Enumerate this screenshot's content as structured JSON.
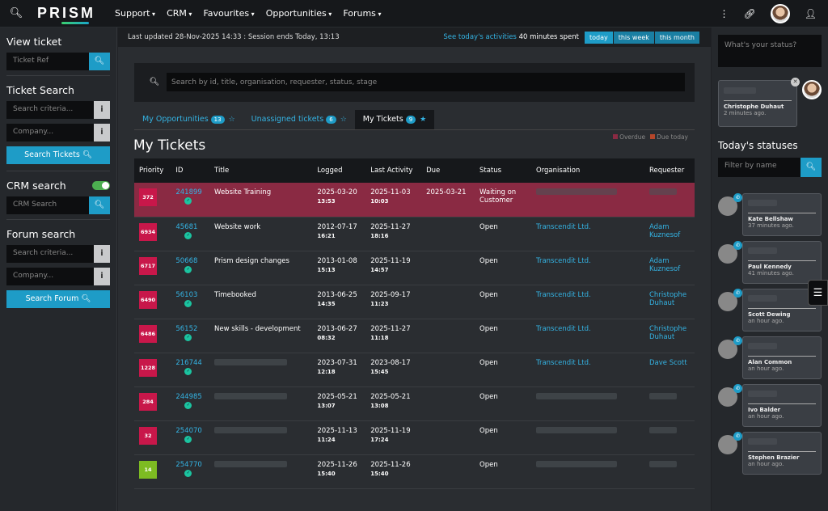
{
  "topbar": {
    "logo": "PRISM",
    "nav": [
      "Support",
      "CRM",
      "Favourites",
      "Opportunities",
      "Forums"
    ]
  },
  "left": {
    "view_ticket": {
      "heading": "View ticket",
      "placeholder": "Ticket Ref"
    },
    "ticket_search": {
      "heading": "Ticket Search",
      "criteria_placeholder": "Search criteria...",
      "company_placeholder": "Company...",
      "button": "Search Tickets"
    },
    "crm_search": {
      "heading": "CRM search",
      "placeholder": "CRM Search"
    },
    "forum_search": {
      "heading": "Forum search",
      "criteria_placeholder": "Search criteria...",
      "company_placeholder": "Company...",
      "button": "Search Forum"
    }
  },
  "status_line": {
    "updated": "Last updated 28-Nov-2025 14:33 : Session ends Today, 13:13",
    "activity_link": "See today's activities",
    "activity_time": "40 minutes spent",
    "periods": [
      "today",
      "this week",
      "this month"
    ]
  },
  "search": {
    "placeholder": "Search by id, title, organisation, requester, status, stage"
  },
  "tabs": [
    {
      "label": "My Opportunities",
      "count": "13"
    },
    {
      "label": "Unassigned tickets",
      "count": "6"
    },
    {
      "label": "My Tickets",
      "count": "9"
    }
  ],
  "legend": {
    "overdue": "Overdue",
    "due_today": "Due today"
  },
  "page_title": "My Tickets",
  "table": {
    "headers": [
      "Priority",
      "ID",
      "Title",
      "Logged",
      "Last Activity",
      "Due",
      "Status",
      "Organisation",
      "Requester"
    ],
    "rows": [
      {
        "priority": "372",
        "color": "#c8174a",
        "id": "241899",
        "title": "Website Training",
        "logged_d": "2025-03-20",
        "logged_t": "13:53",
        "act_d": "2025-11-03",
        "act_t": "10:03",
        "due": "2025-03-21",
        "status": "Waiting on Customer",
        "org": "",
        "req": ""
      },
      {
        "priority": "6934",
        "color": "#c8174a",
        "id": "45681",
        "title": "Website work",
        "logged_d": "2012-07-17",
        "logged_t": "16:21",
        "act_d": "2025-11-27",
        "act_t": "18:16",
        "due": "",
        "status": "Open",
        "org": "Transcendit Ltd.",
        "req": "Adam Kuznesof"
      },
      {
        "priority": "6717",
        "color": "#c8174a",
        "id": "50668",
        "title": "Prism design changes",
        "logged_d": "2013-01-08",
        "logged_t": "15:13",
        "act_d": "2025-11-19",
        "act_t": "14:57",
        "due": "",
        "status": "Open",
        "org": "Transcendit Ltd.",
        "req": "Adam Kuznesof"
      },
      {
        "priority": "6490",
        "color": "#c8174a",
        "id": "56103",
        "title": "Timebooked",
        "logged_d": "2013-06-25",
        "logged_t": "14:35",
        "act_d": "2025-09-17",
        "act_t": "11:23",
        "due": "",
        "status": "Open",
        "org": "Transcendit Ltd.",
        "req": "Christophe Duhaut"
      },
      {
        "priority": "6486",
        "color": "#c8174a",
        "id": "56152",
        "title": "New skills - development",
        "logged_d": "2013-06-27",
        "logged_t": "08:32",
        "act_d": "2025-11-27",
        "act_t": "11:18",
        "due": "",
        "status": "Open",
        "org": "Transcendit Ltd.",
        "req": "Christophe Duhaut"
      },
      {
        "priority": "1228",
        "color": "#c8174a",
        "id": "216744",
        "title": "",
        "logged_d": "2023-07-31",
        "logged_t": "12:18",
        "act_d": "2023-08-17",
        "act_t": "15:45",
        "due": "",
        "status": "Open",
        "org": "Transcendit Ltd.",
        "req": "Dave Scott"
      },
      {
        "priority": "284",
        "color": "#c8174a",
        "id": "244985",
        "title": "",
        "logged_d": "2025-05-21",
        "logged_t": "13:07",
        "act_d": "2025-05-21",
        "act_t": "13:08",
        "due": "",
        "status": "Open",
        "org": "",
        "req": ""
      },
      {
        "priority": "32",
        "color": "#c8174a",
        "id": "254070",
        "title": "",
        "logged_d": "2025-11-13",
        "logged_t": "11:24",
        "act_d": "2025-11-19",
        "act_t": "17:24",
        "due": "",
        "status": "Open",
        "org": "",
        "req": ""
      },
      {
        "priority": "14",
        "color": "#7dbb22",
        "id": "254770",
        "title": "",
        "logged_d": "2025-11-26",
        "logged_t": "15:40",
        "act_d": "2025-11-26",
        "act_t": "15:40",
        "due": "",
        "status": "Open",
        "org": "",
        "req": ""
      }
    ]
  },
  "right": {
    "status_placeholder": "What's your status?",
    "my_status": {
      "name": "Christophe Duhaut",
      "time": "2 minutes ago."
    },
    "heading": "Today's statuses",
    "filter_placeholder": "Filter by name",
    "feed": [
      {
        "name": "Kate Bellshaw",
        "time": "37 minutes ago."
      },
      {
        "name": "Paul Kennedy",
        "time": "41 minutes ago."
      },
      {
        "name": "Scott Dewing",
        "time": "an hour ago."
      },
      {
        "name": "Alan Common",
        "time": "an hour ago."
      },
      {
        "name": "Ivo Balder",
        "time": "an hour ago."
      },
      {
        "name": "Stephen Brazier",
        "time": "an hour ago."
      }
    ]
  }
}
